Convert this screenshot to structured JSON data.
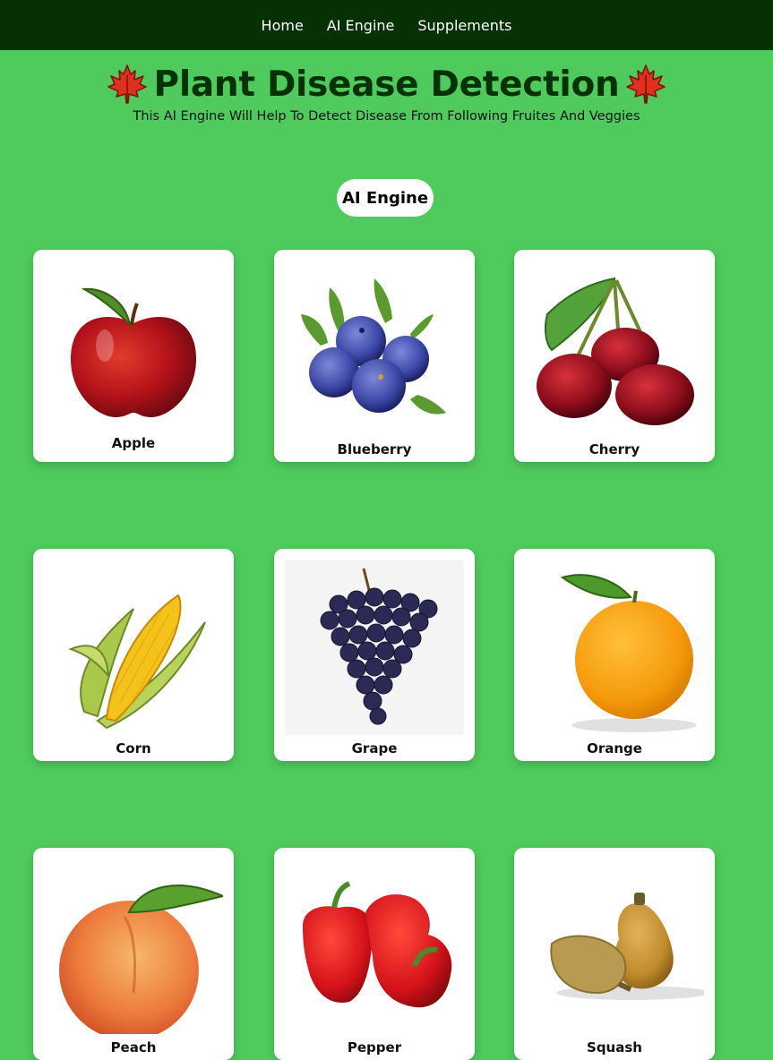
{
  "nav": {
    "items": [
      {
        "label": "Home"
      },
      {
        "label": "AI Engine"
      },
      {
        "label": "Supplements"
      }
    ]
  },
  "header": {
    "title": "Plant Disease Detection",
    "subtitle": "This AI Engine Will Help To Detect Disease From Following Fruites And Veggies",
    "leaf_icon": "maple-leaf-icon"
  },
  "section": {
    "label": "AI Engine"
  },
  "cards": [
    {
      "label": "Apple"
    },
    {
      "label": "Blueberry"
    },
    {
      "label": "Cherry"
    },
    {
      "label": "Corn"
    },
    {
      "label": "Grape"
    },
    {
      "label": "Orange"
    },
    {
      "label": "Peach"
    },
    {
      "label": "Pepper"
    },
    {
      "label": "Squash"
    }
  ],
  "colors": {
    "page_bg": "#4ecb5c",
    "nav_bg": "#053105",
    "title": "#053105"
  }
}
